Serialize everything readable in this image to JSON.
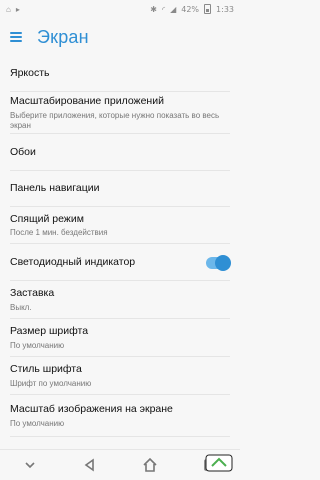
{
  "status_bar": {
    "battery_percent": "42%",
    "time": "1:33"
  },
  "app_bar": {
    "title": "Экран"
  },
  "settings": [
    {
      "title": "Яркость",
      "subtitle": ""
    },
    {
      "title": "Масштабирование приложений",
      "subtitle": "Выберите приложения, которые нужно показать во весь экран"
    },
    {
      "title": "Обои",
      "subtitle": ""
    },
    {
      "title": "Панель навигации",
      "subtitle": ""
    },
    {
      "title": "Спящий режим",
      "subtitle": "После 1 мин. бездействия"
    },
    {
      "title": "Светодиодный индикатор",
      "subtitle": "",
      "toggle": true
    },
    {
      "title": "Заставка",
      "subtitle": "Выкл."
    },
    {
      "title": "Размер шрифта",
      "subtitle": "По умолчанию"
    },
    {
      "title": "Стиль шрифта",
      "subtitle": "Шрифт по умолчанию"
    },
    {
      "title": "Масштаб изображения на экране",
      "subtitle": "По умолчанию"
    }
  ],
  "colors": {
    "accent": "#2f8fd4",
    "toggle_track": "#6cb7ea"
  }
}
